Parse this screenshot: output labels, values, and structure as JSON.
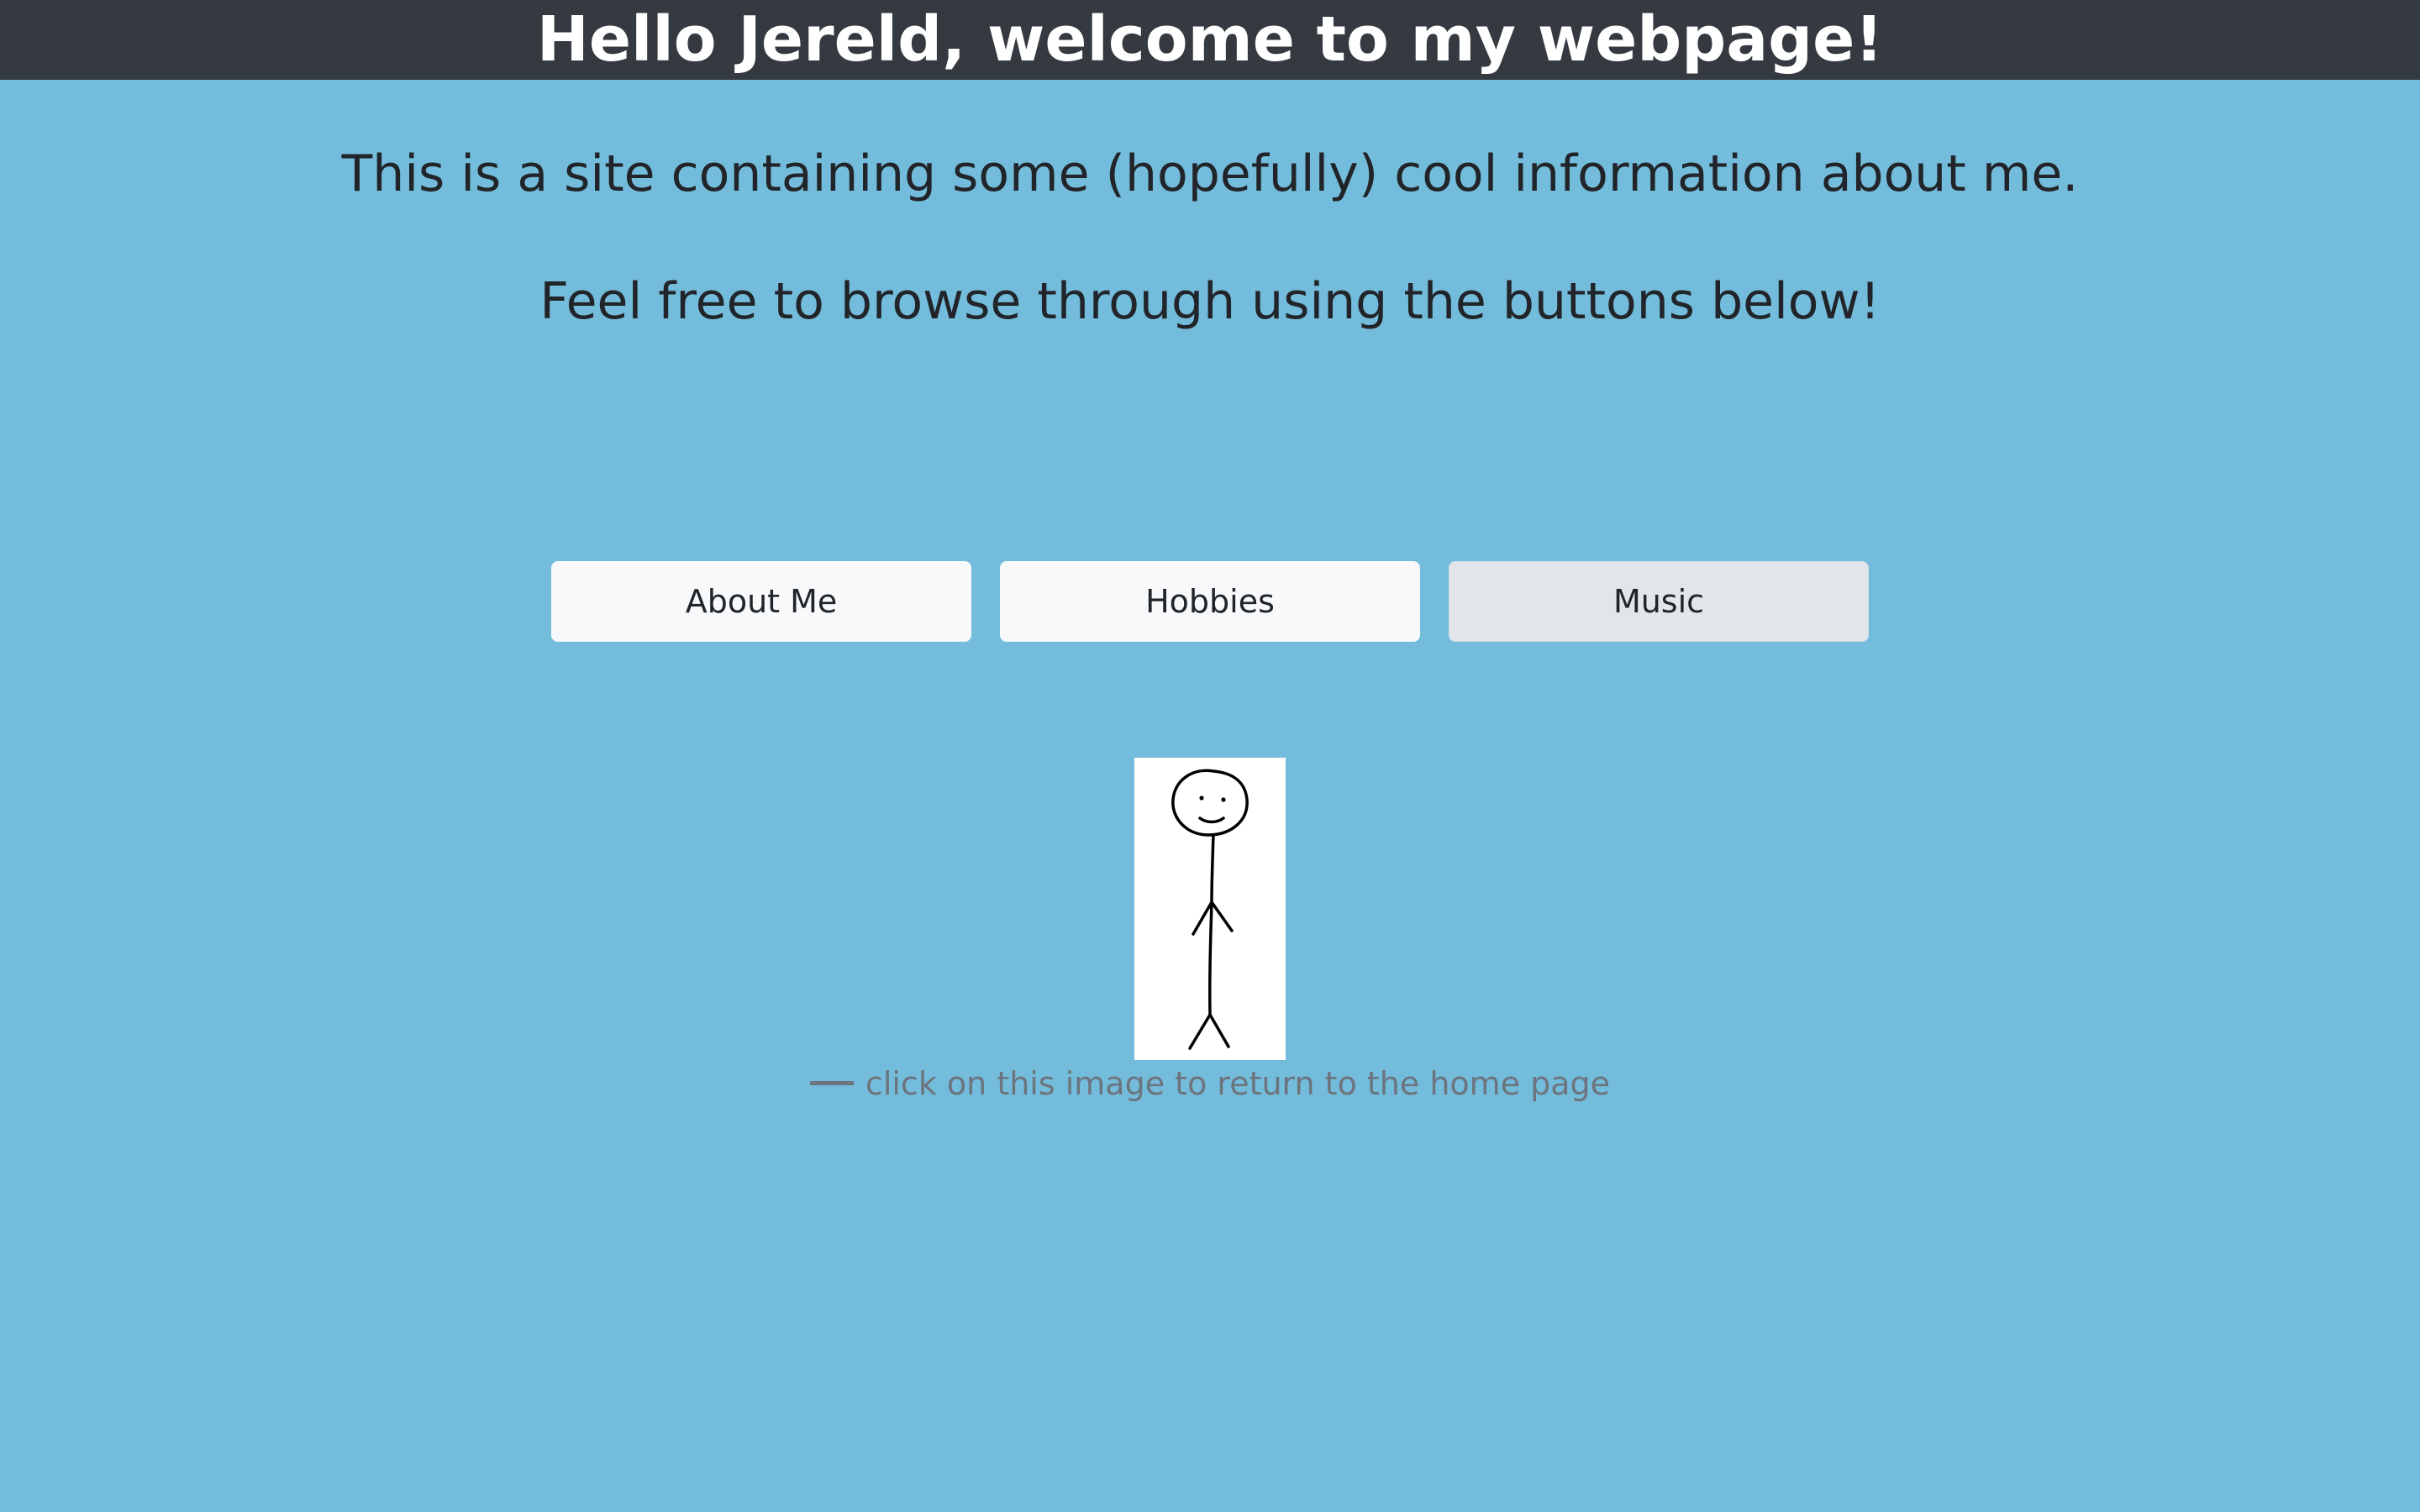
{
  "header": {
    "title": "Hello Jereld, welcome to my webpage!"
  },
  "intro": {
    "line1": "This is a site containing some (hopefully) cool information about me.",
    "line2": "Feel free to browse through using the buttons below!"
  },
  "nav": {
    "buttons": [
      {
        "label": "About Me"
      },
      {
        "label": "Hobbies"
      },
      {
        "label": "Music"
      }
    ]
  },
  "figure": {
    "icon": "stick-figure-icon",
    "caption": "click on this image to return to the home page"
  },
  "colors": {
    "background": "#74bcdb",
    "header": "#343a40",
    "button": "#f8f9fa",
    "button_active": "#e2e6ea",
    "caption": "#6c757d"
  }
}
